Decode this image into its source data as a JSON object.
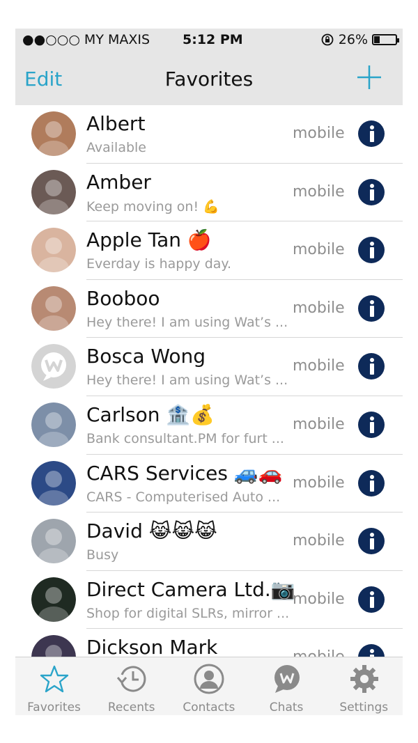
{
  "status_bar": {
    "carrier": "●●○○○ MY MAXIS",
    "time": "5:12 PM",
    "battery": "26%",
    "battery_level": 0.26
  },
  "nav": {
    "edit_label": "Edit",
    "title": "Favorites",
    "add_icon": "plus-icon"
  },
  "contacts": [
    {
      "name": "Albert",
      "status": "Available",
      "label": "mobile",
      "avatar_color": "#b07c5c"
    },
    {
      "name": "Amber",
      "status": "Keep moving on! 💪",
      "label": "mobile",
      "avatar_color": "#6b5a55"
    },
    {
      "name": "Apple Tan 🍎",
      "status": "Everday is happy day.",
      "label": "mobile",
      "avatar_color": "#d9b49f"
    },
    {
      "name": "Booboo",
      "status": "Hey there! I am using Wat’s ...",
      "label": "mobile",
      "avatar_color": "#b88a73"
    },
    {
      "name": "Bosca Wong",
      "status": "Hey there! I am using Wat’s ...",
      "label": "mobile",
      "avatar_color": "#d0d0d0"
    },
    {
      "name": "Carlson 🏦💰",
      "status": "Bank consultant.PM for furt ...",
      "label": "mobile",
      "avatar_color": "#7d8fa8"
    },
    {
      "name": "CARS Services 🚙🚗",
      "status": "CARS - Computerised Auto ...",
      "label": "mobile",
      "avatar_color": "#2c4a86"
    },
    {
      "name": "David 😹😹😹",
      "status": "Busy",
      "label": "mobile",
      "avatar_color": "#9ea5ad"
    },
    {
      "name": "Direct Camera Ltd.📷",
      "status": "Shop for digital SLRs, mirror ...",
      "label": "mobile",
      "avatar_color": "#1f2a22"
    },
    {
      "name": "Dickson Mark",
      "status": "",
      "label": "mobile",
      "avatar_color": "#3d3650"
    }
  ],
  "tabs": [
    {
      "label": "Favorites",
      "icon": "star-icon",
      "active": true
    },
    {
      "label": "Recents",
      "icon": "clock-icon",
      "active": false
    },
    {
      "label": "Contacts",
      "icon": "person-icon",
      "active": false
    },
    {
      "label": "Chats",
      "icon": "chat-bubble-icon",
      "active": false
    },
    {
      "label": "Settings",
      "icon": "gear-icon",
      "active": false
    }
  ],
  "colors": {
    "accent": "#2aa4c9",
    "info_button": "#0e2a59",
    "tab_active": "#2aa4c9",
    "tab_inactive": "#8a8a8a"
  }
}
